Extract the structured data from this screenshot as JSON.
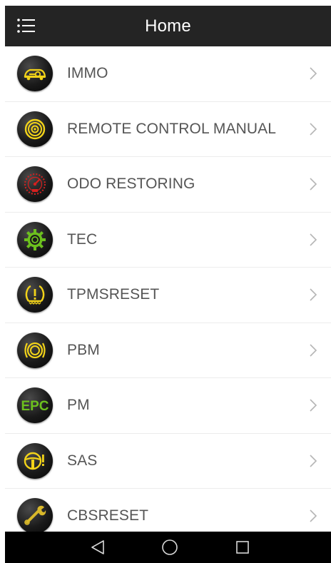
{
  "header": {
    "title": "Home",
    "menu_icon": "menu-icon"
  },
  "colors": {
    "header_bg": "#242424",
    "navbar_bg": "#000000",
    "label_text": "#555555",
    "yellow_icon": "#f2d319",
    "red_icon": "#d4201f",
    "green_icon": "#6cc01e"
  },
  "menu": {
    "items": [
      {
        "label": "IMMO",
        "icon": "car-key-icon"
      },
      {
        "label": "REMOTE CONTROL MANUAL",
        "icon": "remote-target-icon"
      },
      {
        "label": "ODO RESTORING",
        "icon": "odometer-icon"
      },
      {
        "label": "TEC",
        "icon": "gear-icon"
      },
      {
        "label": "TPMSRESET",
        "icon": "tire-pressure-warning-icon"
      },
      {
        "label": "PBM",
        "icon": "brake-disc-icon"
      },
      {
        "label": "PM",
        "icon": "epc-icon",
        "icon_text": "EPC"
      },
      {
        "label": "SAS",
        "icon": "steering-warning-icon"
      },
      {
        "label": "CBSRESET",
        "icon": "wrench-service-icon"
      }
    ]
  },
  "navbar": {
    "back_icon": "back-icon",
    "home_icon": "home-icon",
    "recent_icon": "recent-apps-icon"
  }
}
